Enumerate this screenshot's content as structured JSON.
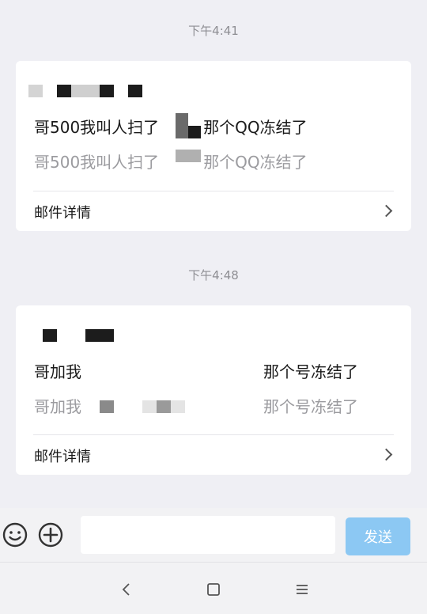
{
  "messages": [
    {
      "timestamp": "下午4:41",
      "subject": "哥500我叫人扫了",
      "subject_tail": "那个QQ冻结了",
      "preview": "哥500我叫人扫了",
      "preview_tail": "那个QQ冻结了",
      "detail_label": "邮件详情"
    },
    {
      "timestamp": "下午4:48",
      "subject": "哥加我",
      "subject_tail": "那个号冻结了",
      "preview": "哥加我",
      "preview_tail": "那个号冻结了",
      "detail_label": "邮件详情"
    }
  ],
  "input": {
    "placeholder": ""
  },
  "send_label": "发送",
  "colors": {
    "accent": "#8cc8f3",
    "background": "#efeff4",
    "card": "#ffffff"
  },
  "icons": [
    "emoji-icon",
    "plus-icon",
    "back-icon",
    "home-icon",
    "menu-icon"
  ]
}
